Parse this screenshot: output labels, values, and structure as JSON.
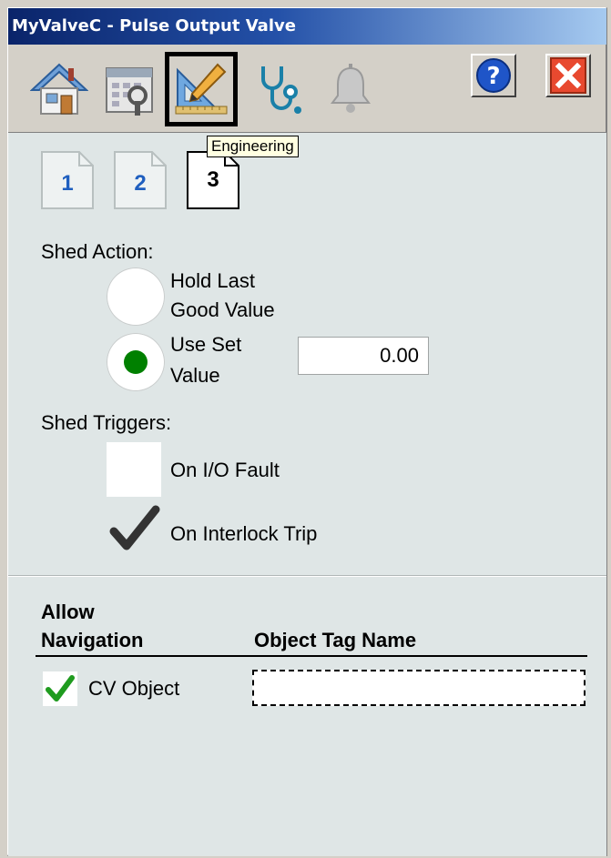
{
  "window": {
    "title": "MyValveC - Pulse Output Valve"
  },
  "toolbar": {
    "buttons": [
      {
        "name": "home",
        "icon": "home-icon"
      },
      {
        "name": "maintenance",
        "icon": "maintenance-icon"
      },
      {
        "name": "engineering",
        "icon": "engineering-icon",
        "active": true
      },
      {
        "name": "diagnostics",
        "icon": "stethoscope-icon"
      },
      {
        "name": "alarms",
        "icon": "bell-icon"
      }
    ],
    "tooltip": "Engineering",
    "help_icon": "help-icon",
    "close_icon": "close-icon"
  },
  "page_tabs": [
    {
      "label": "1",
      "selected": false
    },
    {
      "label": "2",
      "selected": false
    },
    {
      "label": "3",
      "selected": true
    }
  ],
  "shed_action": {
    "label": "Shed Action:",
    "options": [
      {
        "line1": "Hold Last",
        "line2": "Good Value",
        "selected": false
      },
      {
        "line1": "Use Set",
        "line2": "Value",
        "selected": true
      }
    ],
    "set_value": "0.00"
  },
  "shed_triggers": {
    "label": "Shed Triggers:",
    "items": [
      {
        "label": "On I/O Fault",
        "checked": false
      },
      {
        "label": "On Interlock Trip",
        "checked": true
      }
    ]
  },
  "navigation": {
    "col1_line1": "Allow",
    "col1_line2": "Navigation",
    "col2": "Object Tag Name",
    "rows": [
      {
        "label": "CV Object",
        "allowed": true,
        "tag_name": ""
      }
    ]
  },
  "colors": {
    "title_gradient_start": "#0a246a",
    "panel_bg": "#dfe6e6",
    "radio_selected": "#008000",
    "check_green": "#1f9b1f",
    "close_red": "#e8492f",
    "help_blue": "#1f55c8",
    "tab_blue": "#1f5fbf"
  }
}
